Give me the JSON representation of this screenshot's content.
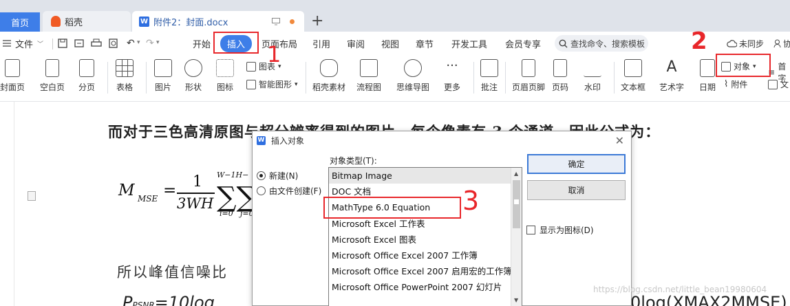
{
  "tabs": {
    "home": "首页",
    "daoke": "稻壳",
    "doc": "附件2：封面.docx",
    "add": "+"
  },
  "menu": {
    "file": "文件",
    "items": [
      "开始",
      "插入",
      "页面布局",
      "引用",
      "审阅",
      "视图",
      "章节",
      "开发工具",
      "会员专享"
    ],
    "search": "查找命令、搜索模板",
    "sync": "未同步",
    "cooperate": "协"
  },
  "ribbon": {
    "items": [
      "封面页",
      "空白页",
      "分页",
      "表格",
      "图片",
      "形状",
      "图标",
      "稻壳素材",
      "流程图",
      "思维导图",
      "更多",
      "批注",
      "页眉页脚",
      "页码",
      "水印",
      "文本框",
      "艺术字",
      "日期"
    ],
    "small": {
      "chart": "图表",
      "smart": "智能图形",
      "object": "对象",
      "attachment": "附件",
      "firstLetter": "首字",
      "text": "文"
    }
  },
  "document": {
    "line1": "而对于三色高清原图与超分辨率得到的图片，每个像素有 3 个通道，因此公式为：",
    "line2": "所以峰值信噪比",
    "formula": {
      "M": "M",
      "sub": "MSE",
      "eq": "=",
      "num": "1",
      "den": "3WH",
      "sigma": "∑∑",
      "top": "W−1H−",
      "b1": "i=0",
      "b2": "j=0"
    },
    "psnr": "P",
    "psnrSub": "PSNR",
    "psnrExpr": "=10log",
    "psnrRight": "0log(XMAX2MMSE)",
    "watermark": "https://blog.csdn.net/little_bean19980604"
  },
  "dialog": {
    "title": "插入对象",
    "radioNew": "新建(N)",
    "radioFile": "由文件创建(F)",
    "listLabel": "对象类型(T):",
    "items": [
      "Bitmap Image",
      "DOC 文档",
      "MathType 6.0 Equation",
      "Microsoft Excel 工作表",
      "Microsoft Excel 图表",
      "Microsoft Office Excel 2007 工作簿",
      "Microsoft Office Excel 2007 启用宏的工作簿",
      "Microsoft Office PowerPoint 2007 幻灯片"
    ],
    "ok": "确定",
    "cancel": "取消",
    "showIcon": "显示为图标(D)"
  },
  "annotations": {
    "one": "1",
    "two": "2",
    "three": "3"
  },
  "colors": {
    "accent": "#3e7ee8",
    "annotation": "#e8262a"
  }
}
